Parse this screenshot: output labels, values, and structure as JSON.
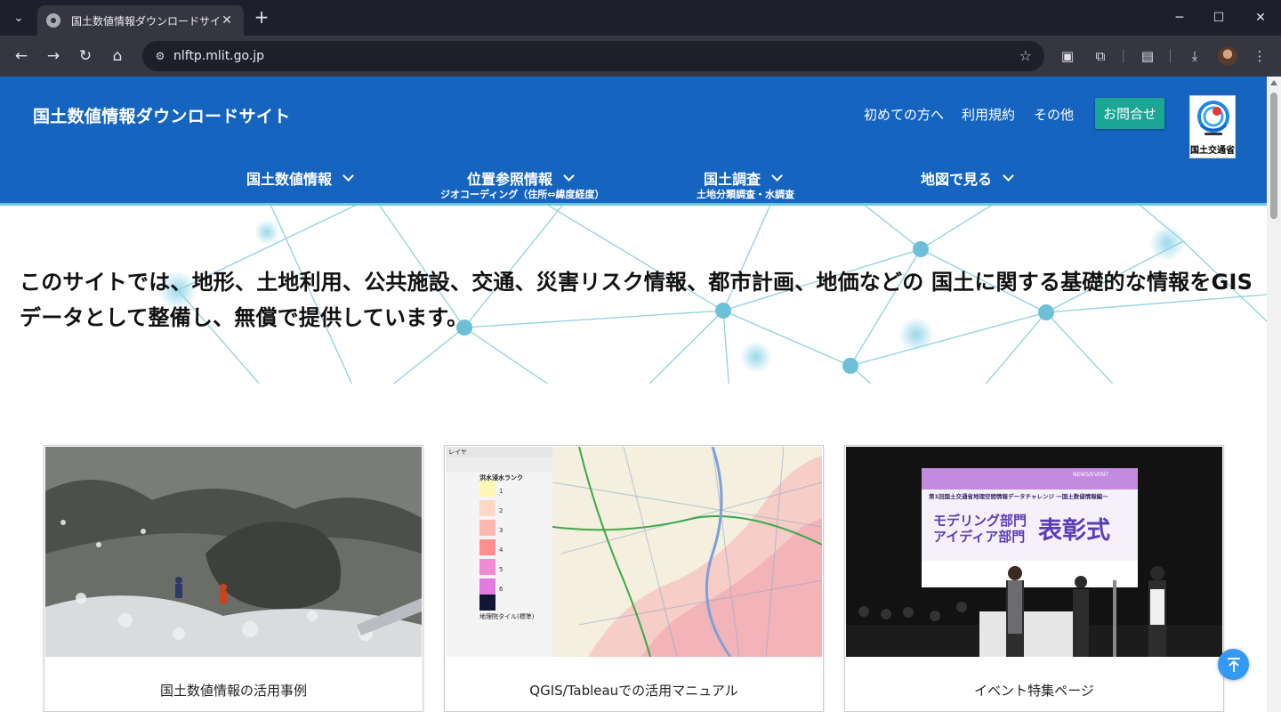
{
  "browser": {
    "tab_title": "国土数値情報ダウンロードサイト",
    "url": "nlftp.mlit.go.jp",
    "icons": [
      "tab-search-icon",
      "favicon-icon",
      "close-icon",
      "plus-icon",
      "minimize-icon",
      "maximize-icon",
      "window-close-icon",
      "back-icon",
      "forward-icon",
      "reload-icon",
      "home-icon",
      "site-info-icon",
      "star-icon",
      "cast-icon",
      "extensions-icon",
      "reading-list-icon",
      "download-icon",
      "avatar",
      "more-icon"
    ]
  },
  "header": {
    "site_title": "国土数値情報ダウンロードサイト",
    "top_links": [
      "初めての方へ",
      "利用規約",
      "その他"
    ],
    "contact_label": "お問合せ",
    "logo_text": "国土交通省",
    "nav": [
      {
        "label": "国土数値情報",
        "sub": ""
      },
      {
        "label": "位置参照情報",
        "sub": "ジオコーディング（住所⇔緯度経度）"
      },
      {
        "label": "国土調査",
        "sub": "土地分類調査・水調査"
      },
      {
        "label": "地図で見る",
        "sub": ""
      }
    ]
  },
  "hero": {
    "text": "このサイトでは、地形、土地利用、公共施設、交通、災害リスク情報、都市計画、地価などの 国土に関する基礎的な情報をGISデータとして整備し、無償で提供しています。"
  },
  "cards": [
    {
      "label": "国土数値情報の活用事例"
    },
    {
      "label": "QGIS/Tableauでの活用マニュアル"
    },
    {
      "label": "イベント特集ページ"
    }
  ],
  "qgis_panel": {
    "title": "レイヤ",
    "layer_group": "洪水浸水ランク",
    "ranks": [
      "1",
      "2",
      "3",
      "4",
      "5",
      "6",
      ""
    ],
    "basemap": "地理院タイル(標準)"
  },
  "event_slide": {
    "tag": "NEWS/EVENT",
    "subtitle": "第1回国土交通省地理空間情報データチャレンジ 〜国土数値情報編〜",
    "line1": "モデリング部門",
    "line2": "アイディア部門",
    "headline": "表彰式"
  },
  "colors": {
    "header_bg": "#1565c0",
    "contact_bg": "#1aa594",
    "network_line": "#7ec8da",
    "network_node": "#6cc0d8",
    "back_to_top": "#3399f3"
  }
}
